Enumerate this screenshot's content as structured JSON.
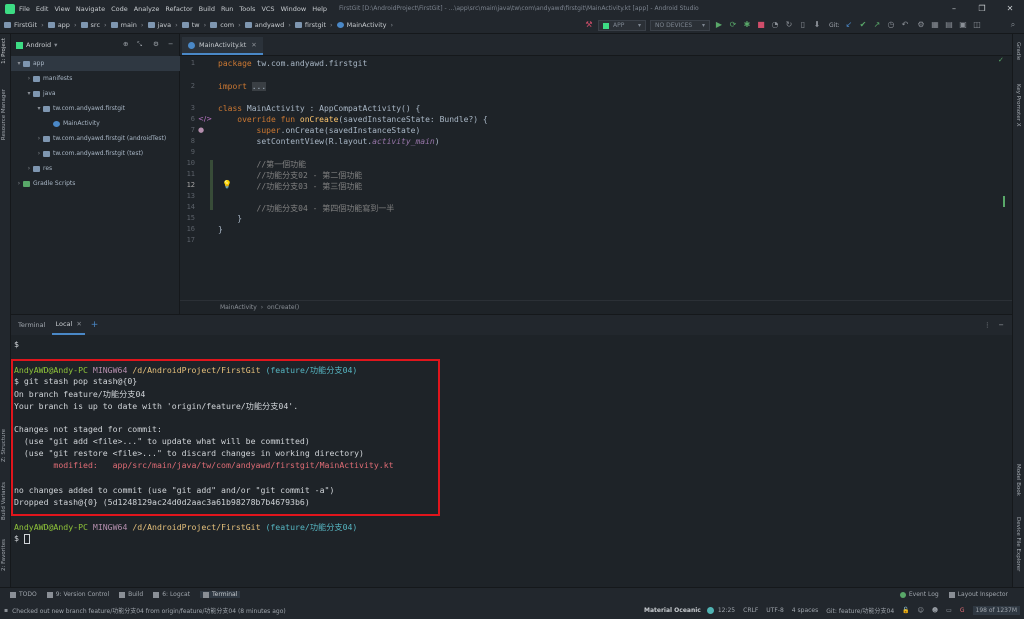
{
  "menubar": {
    "items": [
      "File",
      "Edit",
      "View",
      "Navigate",
      "Code",
      "Analyze",
      "Refactor",
      "Build",
      "Run",
      "Tools",
      "VCS",
      "Window",
      "Help"
    ],
    "title": "FirstGit [D:\\AndroidProject\\FirstGit] - ...\\app\\src\\main\\java\\tw\\com\\andyawd\\firstgit\\MainActivity.kt [app] - Android Studio"
  },
  "navbar": {
    "crumbs": [
      "FirstGit",
      "app",
      "src",
      "main",
      "java",
      "tw",
      "com",
      "andyawd",
      "firstgit",
      "MainActivity"
    ],
    "run_config": "APP",
    "devices": "NO DEVICES",
    "git_label": "Git:"
  },
  "project": {
    "view": "Android",
    "tree": [
      {
        "label": "app",
        "depth": 0,
        "arrow": "▾",
        "kind": "folder"
      },
      {
        "label": "manifests",
        "depth": 1,
        "arrow": "›",
        "kind": "folder"
      },
      {
        "label": "java",
        "depth": 1,
        "arrow": "▾",
        "kind": "folder"
      },
      {
        "label": "tw.com.andyawd.firstgit",
        "depth": 2,
        "arrow": "▾",
        "kind": "folder"
      },
      {
        "label": "MainActivity",
        "depth": 3,
        "arrow": "",
        "kind": "class"
      },
      {
        "label": "tw.com.andyawd.firstgit (androidTest)",
        "depth": 2,
        "arrow": "›",
        "kind": "folder"
      },
      {
        "label": "tw.com.andyawd.firstgit (test)",
        "depth": 2,
        "arrow": "›",
        "kind": "folder"
      },
      {
        "label": "res",
        "depth": 1,
        "arrow": "›",
        "kind": "folder"
      },
      {
        "label": "Gradle Scripts",
        "depth": 0,
        "arrow": "›",
        "kind": "gradle"
      }
    ]
  },
  "editor": {
    "tab": "MainActivity.kt",
    "line_numbers": [
      "1",
      "2",
      "3",
      "6",
      "7",
      "8",
      "9",
      "10",
      "11",
      "12",
      "13",
      "14",
      "15",
      "16",
      "17"
    ],
    "breadcrumb": [
      "MainActivity",
      "onCreate()"
    ]
  },
  "terminal": {
    "tabs": [
      "Terminal",
      "Local"
    ],
    "user": "AndyAWD@Andy-PC",
    "shell": "MINGW64",
    "path": "/d/AndroidProject/FirstGit",
    "branch": "(feature/功能分支04)",
    "prompt": "$",
    "cmd": "$ git stash pop stash@{0}",
    "on_branch": "On branch feature/功能分支04",
    "up_to_date": "Your branch is up to date with 'origin/feature/功能分支04'.",
    "changes": "Changes not staged for commit:",
    "hint1": "  (use \"git add <file>...\" to update what will be committed)",
    "hint2": "  (use \"git restore <file>...\" to discard changes in working directory)",
    "modified_label": "        modified:   ",
    "modified_file": "app/src/main/java/tw/com/andyawd/firstgit/MainActivity.kt",
    "no_changes": "no changes added to commit (use \"git add\" and/or \"git commit -a\")",
    "dropped": "Dropped stash@{0} (5d1248129ac24d0d2aac3a61b98278b7b46793b6)"
  },
  "left_stripe": [
    "1: Project",
    "Resource Manager",
    "Z: Structure",
    "Build Variants",
    "2: Favorites"
  ],
  "right_stripe": [
    "Gradle",
    "Key Promoter X",
    "Model Book",
    "Device File Explorer"
  ],
  "bottom_tools": [
    "TODO",
    "9: Version Control",
    "Build",
    "6: Logcat",
    "Terminal"
  ],
  "bottom_right": [
    "Event Log",
    "Layout Inspector"
  ],
  "status": {
    "message": "Checked out new branch feature/功能分支04 from origin/feature/功能分支04 (8 minutes ago)",
    "theme": "Material Oceanic",
    "pos": "12:25",
    "eol": "CRLF",
    "enc": "UTF-8",
    "indent": "4 spaces",
    "git": "Git: feature/功能分支04",
    "memory": "198 of 1237M"
  }
}
